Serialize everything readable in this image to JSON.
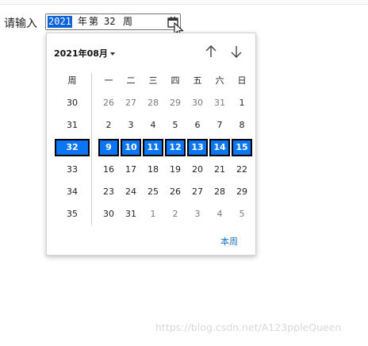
{
  "form": {
    "label": "请输入",
    "week_input": {
      "year": "2021",
      "year_word": "年",
      "ordinal_word": "第",
      "week": "32",
      "week_word": "周"
    }
  },
  "picker": {
    "month_label": "2021年08月",
    "week_header": "周",
    "weekdays": [
      "一",
      "二",
      "三",
      "四",
      "五",
      "六",
      "日"
    ],
    "rows": [
      {
        "week": "30",
        "days": [
          "26",
          "27",
          "28",
          "29",
          "30",
          "31",
          "1"
        ],
        "muted": [
          true,
          true,
          true,
          true,
          true,
          true,
          false
        ],
        "selected": false
      },
      {
        "week": "31",
        "days": [
          "2",
          "3",
          "4",
          "5",
          "6",
          "7",
          "8"
        ],
        "muted": [
          false,
          false,
          false,
          false,
          false,
          false,
          false
        ],
        "selected": false
      },
      {
        "week": "32",
        "days": [
          "9",
          "10",
          "11",
          "12",
          "13",
          "14",
          "15"
        ],
        "muted": [
          false,
          false,
          false,
          false,
          false,
          false,
          false
        ],
        "selected": true
      },
      {
        "week": "33",
        "days": [
          "16",
          "17",
          "18",
          "19",
          "20",
          "21",
          "22"
        ],
        "muted": [
          false,
          false,
          false,
          false,
          false,
          false,
          false
        ],
        "selected": false
      },
      {
        "week": "34",
        "days": [
          "23",
          "24",
          "25",
          "26",
          "27",
          "28",
          "29"
        ],
        "muted": [
          false,
          false,
          false,
          false,
          false,
          false,
          false
        ],
        "selected": false
      },
      {
        "week": "35",
        "days": [
          "30",
          "31",
          "1",
          "2",
          "3",
          "4",
          "5"
        ],
        "muted": [
          false,
          false,
          true,
          true,
          true,
          true,
          true
        ],
        "selected": false
      }
    ],
    "this_week_label": "本周"
  },
  "colors": {
    "selection": "#0a76f6",
    "link": "#1a73c8",
    "muted_text": "#7a7a7a"
  },
  "icons": {
    "calendar": "calendar-icon",
    "up": "arrow-up-icon",
    "down": "arrow-down-icon"
  },
  "watermark": "https://blog.csdn.net/A123ppleQueen"
}
